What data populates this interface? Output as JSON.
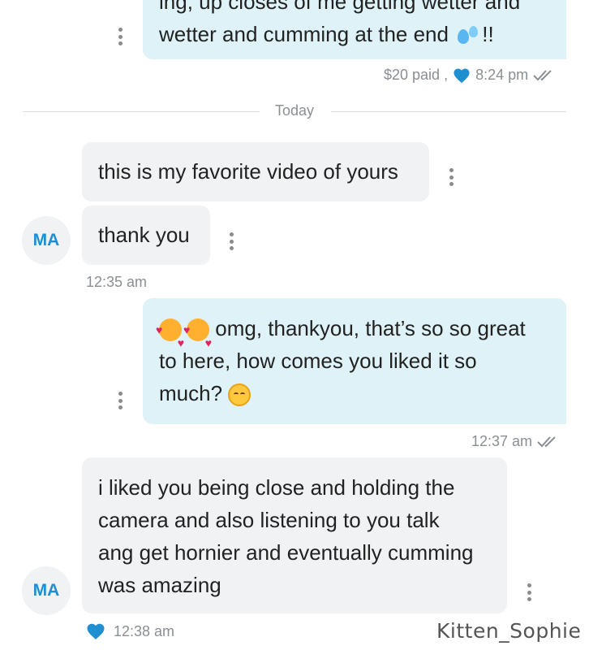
{
  "colors": {
    "outgoing_bubble": "#def2f8",
    "incoming_bubble": "#f0f2f4",
    "accent_blue": "#1f8fd0",
    "meta_gray": "#8a8f94"
  },
  "messages": {
    "m1": {
      "line0": "ing, up closes of me getting wetter and",
      "line1": "wetter and cumming at the end",
      "line1_suffix": "!!",
      "paid": "$20 paid ,",
      "time": "8:24 pm"
    },
    "divider_label": "Today",
    "m2": {
      "text": "this is my favorite video of yours"
    },
    "m3": {
      "text": "thank you",
      "time": "12:35 am",
      "avatar": "MA"
    },
    "m4": {
      "line1": "omg, thankyou, that’s so so great",
      "line2": "to here, how comes you liked it so",
      "line3": "much?",
      "time": "12:37 am"
    },
    "m5": {
      "line1": "i liked you being close and holding the",
      "line2": "camera and also listening to you talk",
      "line3": "ang get hornier and eventually cumming",
      "line4": "was amazing",
      "time": "12:38 am",
      "avatar": "MA"
    }
  },
  "watermark": "Kitten_Sophie",
  "icons": [
    "more-vertical-icon",
    "heart-icon",
    "double-check-icon",
    "sweat-droplets-emoji",
    "smiling-face-with-hearts-emoji",
    "smiling-face-emoji"
  ]
}
